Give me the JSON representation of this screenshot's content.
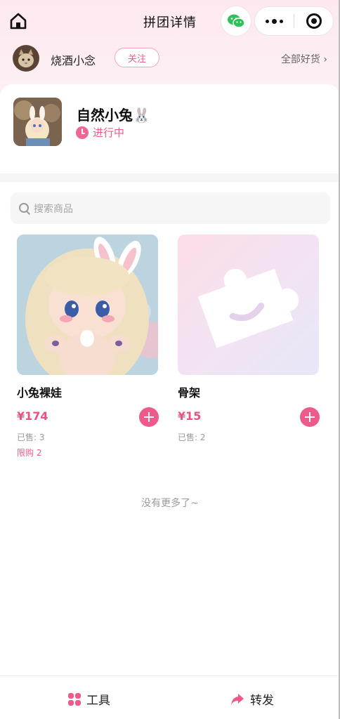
{
  "nav": {
    "title": "拼团详情",
    "home_icon": "home-icon",
    "wechat_icon": "wechat-icon",
    "more_icon": "more-dots-icon",
    "close_icon": "target-close-icon"
  },
  "seller": {
    "name": "烧酒小念",
    "follow_label": "关注",
    "all_goods_label": "全部好货 ›"
  },
  "group": {
    "title": "自然小兔🐰",
    "status": "进行中",
    "accent_color": "#ef5a8c"
  },
  "search": {
    "placeholder": "搜索商品"
  },
  "products": [
    {
      "name": "小兔裸娃",
      "price": "¥174",
      "sold": "已售: 3",
      "limit": "限购 2"
    },
    {
      "name": "骨架",
      "price": "¥15",
      "sold": "已售: 2"
    }
  ],
  "footer_text": "没有更多了~",
  "bottom_bar": {
    "tool_label": "工具",
    "share_label": "转发"
  }
}
